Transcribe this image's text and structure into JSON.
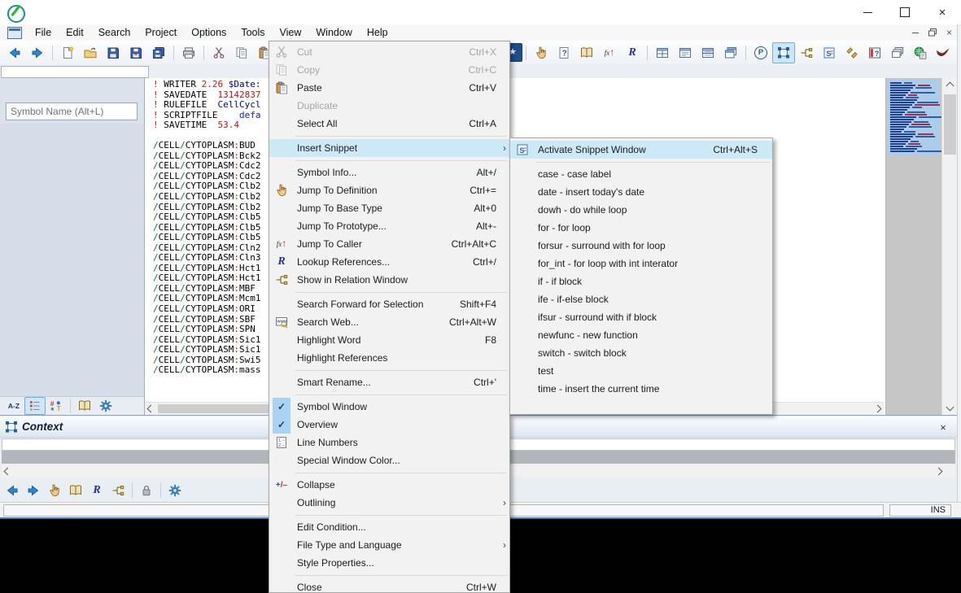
{
  "menubar": {
    "items": [
      "File",
      "Edit",
      "Search",
      "Project",
      "Options",
      "Tools",
      "View",
      "Window",
      "Help"
    ]
  },
  "toolbar": {
    "left": [
      {
        "icon": "back-arrow"
      },
      {
        "icon": "forward-arrow"
      },
      {
        "sep": true
      },
      {
        "icon": "new-file"
      },
      {
        "icon": "open-file"
      },
      {
        "icon": "save"
      },
      {
        "icon": "save-as"
      },
      {
        "icon": "save-all"
      },
      {
        "sep": true
      },
      {
        "icon": "print"
      },
      {
        "sep": true
      },
      {
        "icon": "cut"
      },
      {
        "icon": "copy"
      },
      {
        "icon": "paste"
      }
    ],
    "right": [
      {
        "icon": "favorites-star",
        "dark": true
      },
      {
        "sep": true
      },
      {
        "icon": "jump-definition-hand"
      },
      {
        "icon": "symbol-info"
      },
      {
        "icon": "browse-book"
      },
      {
        "icon": "jump-caller-fx"
      },
      {
        "icon": "lookup-references-r"
      },
      {
        "sep": true
      },
      {
        "icon": "tile-windows"
      },
      {
        "icon": "single-window"
      },
      {
        "icon": "split-window"
      },
      {
        "icon": "cascade-windows"
      },
      {
        "sep": true
      },
      {
        "icon": "parse-p"
      },
      {
        "icon": "context-window",
        "pressed": true
      },
      {
        "icon": "relation-window"
      },
      {
        "icon": "snippet"
      },
      {
        "icon": "refactor-pieces"
      },
      {
        "icon": "help-window"
      },
      {
        "icon": "window-stack"
      },
      {
        "icon": "web-page"
      },
      {
        "icon": "hawk"
      },
      {
        "sep": true
      },
      {
        "sep": true
      },
      {
        "sep": true
      }
    ]
  },
  "symbol_panel": {
    "filter_value": "",
    "symbol_input_placeholder": "Symbol Name (Alt+L)",
    "tabs": [
      {
        "icon": "sort-az"
      },
      {
        "icon": "symbol-list",
        "pressed": true
      },
      {
        "icon": "symbol-types"
      },
      {
        "sep": true
      },
      {
        "icon": "browse-book"
      },
      {
        "icon": "options-gear"
      }
    ]
  },
  "editor": {
    "header_lines": [
      [
        [
          "r",
          "! "
        ],
        [
          "k",
          "WRITER "
        ],
        [
          "r",
          "2.26 "
        ],
        [
          "v",
          "$Date:"
        ]
      ],
      [
        [
          "r",
          "! "
        ],
        [
          "k",
          "SAVEDATE  "
        ],
        [
          "r",
          "13142837"
        ]
      ],
      [
        [
          "r",
          "! "
        ],
        [
          "k",
          "RULEFILE  "
        ],
        [
          "v",
          "CellCycl"
        ]
      ],
      [
        [
          "r",
          "! "
        ],
        [
          "k",
          "SCRIPTFILE    "
        ],
        [
          "b",
          "defa"
        ]
      ],
      [
        [
          "r",
          "! "
        ],
        [
          "k",
          "SAVETIME  "
        ],
        [
          "r",
          "53.4"
        ]
      ]
    ],
    "path_slash": "/",
    "path_seg1": "CELL",
    "path_seg2": "CYTOPLASM",
    "path_colon": ":",
    "symbols": [
      "BUD ",
      "Bck2",
      "Cdc2",
      "Cdc2",
      "Clb2",
      "Clb2",
      "Clb2",
      "Clb5",
      "Clb5",
      "Clb5",
      "Cln2",
      "Cln3",
      "Hct1",
      "Hct1",
      "MBF ",
      "Mcm1",
      "ORI ",
      "SBF ",
      "SPN ",
      "Sic1",
      "Sic1",
      "Swi5",
      "mass"
    ]
  },
  "window_menu": {
    "items": [
      {
        "label": "Cut",
        "shortcut": "Ctrl+X",
        "icon": "cut",
        "disabled": true
      },
      {
        "label": "Copy",
        "shortcut": "Ctrl+C",
        "icon": "copy",
        "disabled": true
      },
      {
        "label": "Paste",
        "shortcut": "Ctrl+V",
        "icon": "paste"
      },
      {
        "label": "Duplicate",
        "disabled": true
      },
      {
        "label": "Select All",
        "shortcut": "Ctrl+A"
      },
      {
        "sep": true
      },
      {
        "label": "Insert Snippet",
        "submenu": true,
        "highlighted": true
      },
      {
        "sep": true
      },
      {
        "label": "Symbol Info...",
        "shortcut": "Alt+/"
      },
      {
        "label": "Jump To Definition",
        "shortcut": "Ctrl+=",
        "icon": "jump-definition-hand"
      },
      {
        "label": "Jump To Base Type",
        "shortcut": "Alt+0"
      },
      {
        "label": "Jump To Prototype...",
        "shortcut": "Alt+-"
      },
      {
        "label": "Jump To Caller",
        "shortcut": "Ctrl+Alt+C",
        "icon": "jump-caller-fx"
      },
      {
        "label": "Lookup References...",
        "shortcut": "Ctrl+/",
        "icon": "lookup-references-r"
      },
      {
        "label": "Show in Relation Window",
        "icon": "relation-window"
      },
      {
        "sep": true
      },
      {
        "label": "Search Forward for Selection",
        "shortcut": "Shift+F4"
      },
      {
        "label": "Search Web...",
        "shortcut": "Ctrl+Alt+W",
        "icon": "search-web-www"
      },
      {
        "label": "Highlight Word",
        "shortcut": "F8"
      },
      {
        "label": "Highlight References"
      },
      {
        "sep": true
      },
      {
        "label": "Smart Rename...",
        "shortcut": "Ctrl+'"
      },
      {
        "sep": true
      },
      {
        "label": "Symbol Window",
        "checked": true
      },
      {
        "label": "Overview",
        "checked": true
      },
      {
        "label": "Line Numbers",
        "icon": "line-numbers"
      },
      {
        "label": "Special Window Color..."
      },
      {
        "sep": true
      },
      {
        "label": "Collapse",
        "icon": "collapse"
      },
      {
        "label": "Outlining",
        "submenu": true
      },
      {
        "sep": true
      },
      {
        "label": "Edit Condition..."
      },
      {
        "label": "File Type and Language",
        "submenu": true
      },
      {
        "label": "Style Properties..."
      },
      {
        "sep": true
      },
      {
        "label": "Close",
        "shortcut": "Ctrl+W"
      }
    ]
  },
  "snippet_menu": {
    "items": [
      {
        "label": "Activate Snippet Window",
        "shortcut": "Ctrl+Alt+S",
        "icon": "snippet",
        "highlighted": true
      },
      {
        "sep": true
      },
      {
        "label": "case - case label"
      },
      {
        "label": "date - insert today's date"
      },
      {
        "label": "dowh - do while loop"
      },
      {
        "label": "for - for loop"
      },
      {
        "label": "forsur - surround with for loop"
      },
      {
        "label": "for_int - for loop with int interator"
      },
      {
        "label": "if - if block"
      },
      {
        "label": "ife - if-else block"
      },
      {
        "label": "ifsur - surround with if block"
      },
      {
        "label": "newfunc - new function"
      },
      {
        "label": "switch - switch block"
      },
      {
        "label": "test"
      },
      {
        "label": "time - insert the current time"
      }
    ]
  },
  "context_panel": {
    "title": "Context",
    "toolbar": [
      {
        "icon": "back-arrow"
      },
      {
        "icon": "forward-arrow"
      },
      {
        "icon": "jump-definition-hand"
      },
      {
        "icon": "browse-book"
      },
      {
        "icon": "lookup-references-r"
      },
      {
        "icon": "relation-window"
      },
      {
        "sep": true
      },
      {
        "icon": "lock"
      },
      {
        "sep": true
      },
      {
        "icon": "options-gear"
      }
    ]
  },
  "statusbar": {
    "mode": "INS"
  },
  "colors": {
    "menu_highlight": "#cde8f7",
    "check_block": "#a9d3f2",
    "code_red": "#cc1111",
    "code_navy": "#000085",
    "code_blue": "#1414d6",
    "code_green": "#0a7a30",
    "minimap_view": "#a9cdea",
    "star_button": "#1d4f8f"
  }
}
